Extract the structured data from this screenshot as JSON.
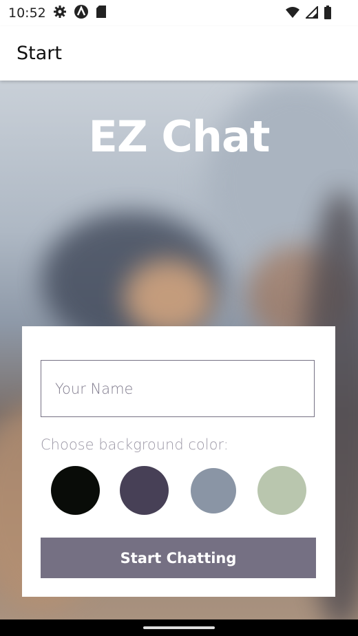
{
  "status_bar": {
    "time": "10:52",
    "icons_left": [
      "gear-icon",
      "a-circle-icon",
      "sd-card-icon"
    ],
    "icons_right": [
      "wifi-icon",
      "signal-icon",
      "battery-icon"
    ]
  },
  "app_bar": {
    "title": "Start"
  },
  "hero": {
    "title": "EZ Chat"
  },
  "form": {
    "name_placeholder": "Your Name",
    "color_label": "Choose background color:",
    "colors": [
      "#090C08",
      "#474056",
      "#8A95A5",
      "#B9C6AE"
    ],
    "button_label": "Start Chatting"
  }
}
